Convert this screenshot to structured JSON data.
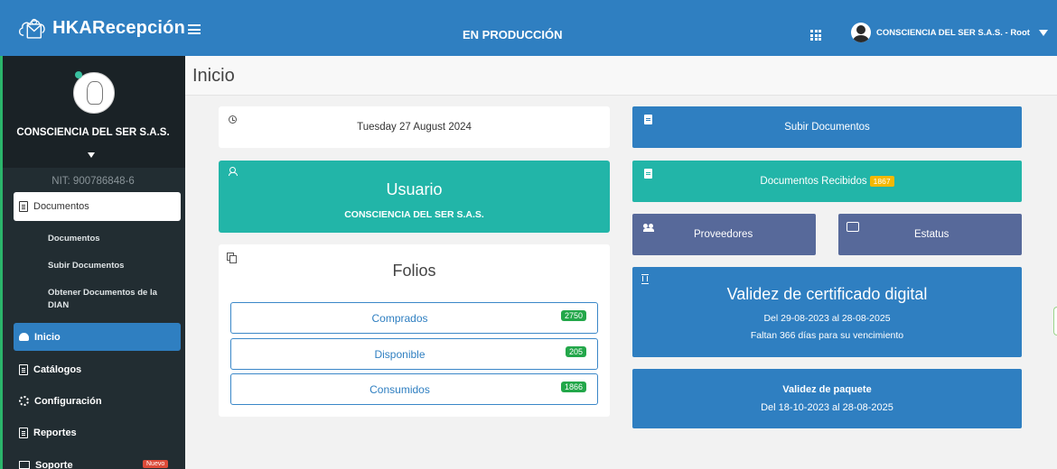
{
  "app": {
    "brand": "HKARecepción",
    "environment": "EN PRODUCCIÓN",
    "user_label": "CONSCIENCIA DEL SER S.A.S. - Root"
  },
  "sidebar": {
    "company": "CONSCIENCIA DEL SER S.A.S.",
    "nit": "NIT: 900786848-6",
    "documentos_label": "Documentos",
    "sub_items": [
      "Documentos",
      "Subir Documentos",
      "Obtener Documentos de la DIAN"
    ],
    "inicio_label": "Inicio",
    "catalogos_label": "Catálogos",
    "configuracion_label": "Configuración",
    "reportes_label": "Reportes",
    "soporte_label": "Soporte",
    "nuevo_badge": "Nuevo"
  },
  "page": {
    "title": "Inicio"
  },
  "date_card": {
    "date": "Tuesday 27 August 2024"
  },
  "usuario_card": {
    "title": "Usuario",
    "company": "CONSCIENCIA DEL SER S.A.S."
  },
  "folios": {
    "title": "Folios",
    "rows": [
      {
        "label": "Comprados",
        "count": "2750"
      },
      {
        "label": "Disponible",
        "count": "205"
      },
      {
        "label": "Consumidos",
        "count": "1866"
      }
    ]
  },
  "actions": {
    "subir": "Subir Documentos",
    "recibidos": "Documentos Recibidos",
    "recibidos_count": "1867",
    "proveedores": "Proveedores",
    "estatus": "Estatus"
  },
  "certificado": {
    "title": "Validez de certificado digital",
    "range": "Del 29-08-2023 al 28-08-2025",
    "remaining": "Faltan 366 días para su vencimiento"
  },
  "paquete": {
    "title": "Validez de paquete",
    "range": "Del 18-10-2023 al 28-08-2025"
  },
  "colors": {
    "primary": "#2f7fc1",
    "teal": "#22b5a8",
    "slate": "#57699a",
    "sidebar": "#222d32",
    "success": "#23a74a",
    "warning": "#f5b800",
    "danger": "#dd4b39"
  }
}
